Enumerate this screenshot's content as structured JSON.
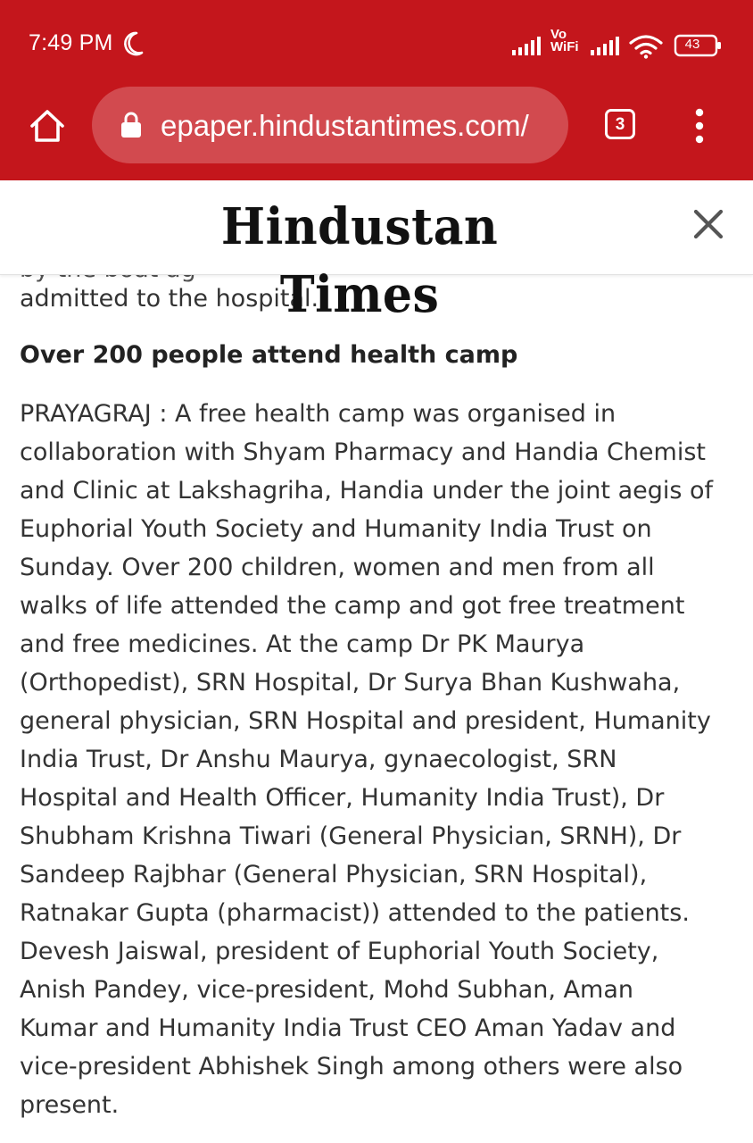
{
  "status_bar": {
    "time": "7:49 PM",
    "network_label_line1": "Vo",
    "network_label_line2": "WiFi",
    "battery": "43"
  },
  "browser": {
    "url": "epaper.hindustantimes.com/",
    "tab_count": "3"
  },
  "header": {
    "logo_text": "Hindustan Times"
  },
  "article": {
    "clipped_previous_text": "by the boat ag",
    "lead_line": "admitted to the hospital.",
    "headline": "Over 200 people attend health camp",
    "body_lines": [
      "PRAYAGRAJ : A free health camp was organised in",
      "collaboration with Shyam Pharmacy and Handia Chemist",
      "and Clinic at Lakshagriha, Handia under the joint aegis of",
      "Euphorial Youth Society and Humanity India Trust on",
      "Sunday. Over 200 children, women and men from all",
      "walks of life attended the camp and got free treatment",
      "and free medicines. At the camp Dr PK Maurya",
      "(Orthopedist), SRN Hospital, Dr Surya Bhan Kushwaha,",
      "general physician, SRN Hospital and president, Humanity",
      "India Trust, Dr Anshu Maurya, gynaecologist, SRN",
      "Hospital and Health Officer, Humanity India Trust), Dr",
      "Shubham Krishna Tiwari (General Physician, SRNH), Dr",
      "Sandeep Rajbhar (General Physician, SRN Hospital),",
      "Ratnakar Gupta (pharmacist)) attended to the patients.",
      "Devesh Jaiswal, president of Euphorial Youth Society,",
      "Anish Pandey, vice-president, Mohd Subhan, Aman",
      "Kumar and Humanity India Trust CEO Aman Yadav and",
      "vice-president Abhishek Singh among others were also",
      "present."
    ]
  },
  "colors": {
    "brand_red": "#c4161c",
    "url_bar": "#d24a4f",
    "body_text": "#333333"
  },
  "icons": [
    "moon-icon",
    "signal-icon",
    "wifi-icon",
    "battery-icon",
    "home-icon",
    "lock-icon",
    "tabs-icon",
    "more-vert-icon",
    "close-icon"
  ]
}
